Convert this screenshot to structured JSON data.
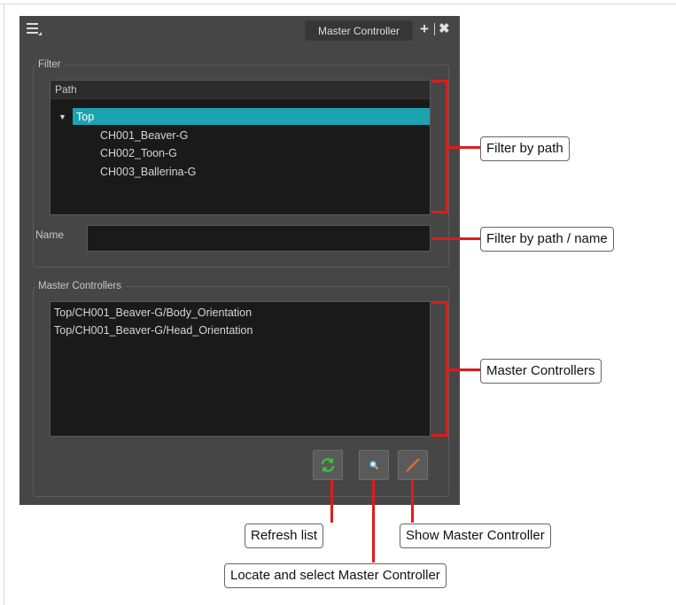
{
  "panel": {
    "tab_label": "Master Controller",
    "menu_icon": "hamburger-menu-icon",
    "plus_icon": "plus-icon",
    "close_icon": "close-icon"
  },
  "filter": {
    "legend": "Filter",
    "tree_header": "Path",
    "tree_root": "Top",
    "tree_children": [
      "CH001_Beaver-G",
      "CH002_Toon-G",
      "CH003_Ballerina-G"
    ],
    "name_label": "Name",
    "name_value": ""
  },
  "master_controllers": {
    "legend": "Master Controllers",
    "items": [
      "Top/CH001_Beaver-G/Body_Orientation",
      "Top/CH001_Beaver-G/Head_Orientation"
    ]
  },
  "buttons": {
    "refresh_icon": "refresh-icon",
    "locate_icon": "locate-icon",
    "show_icon": "show-controller-icon"
  },
  "callouts": {
    "filter_by_path": "Filter by path",
    "filter_by_path_name": "Filter by path / name",
    "master_controllers": "Master Controllers",
    "refresh_list": "Refresh list",
    "locate_select": "Locate and select Master Controller",
    "show_master": "Show Master Controller"
  },
  "colors": {
    "panel_bg": "#464646",
    "selection": "#1ba3b0",
    "annotation_red": "#e21a1a"
  }
}
